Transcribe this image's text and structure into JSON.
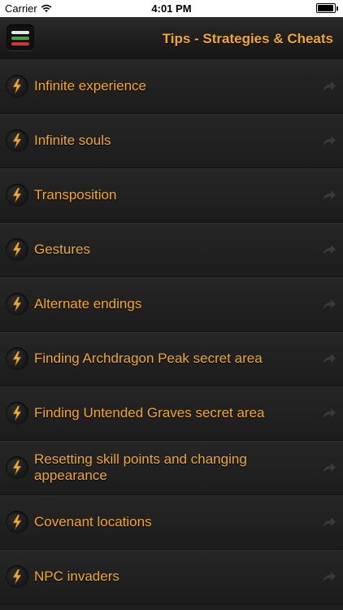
{
  "status_bar": {
    "carrier": "Carrier",
    "time": "4:01 PM"
  },
  "nav": {
    "title": "Tips - Strategies & Cheats",
    "menu_colors": [
      "#e6e6e6",
      "#3fa93f",
      "#d93030"
    ]
  },
  "accent_color": "#f0a830",
  "items": [
    {
      "label": "Infinite experience"
    },
    {
      "label": "Infinite souls"
    },
    {
      "label": "Transposition"
    },
    {
      "label": "Gestures"
    },
    {
      "label": "Alternate endings"
    },
    {
      "label": "Finding Archdragon Peak secret area"
    },
    {
      "label": "Finding Untended Graves secret area"
    },
    {
      "label": "Resetting skill points and changing appearance"
    },
    {
      "label": "Covenant locations"
    },
    {
      "label": "NPC invaders"
    }
  ]
}
